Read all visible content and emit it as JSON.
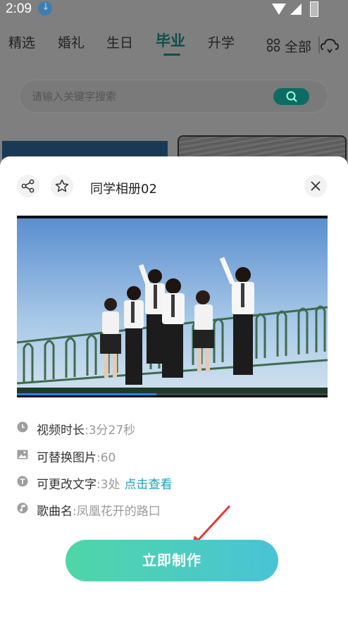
{
  "status_bar": {
    "time": "2:09"
  },
  "tabs": [
    {
      "label": "精选"
    },
    {
      "label": "婚礼"
    },
    {
      "label": "生日"
    },
    {
      "label": "毕业",
      "active": true
    },
    {
      "label": "升学"
    }
  ],
  "all_label": "全部",
  "search": {
    "placeholder": "请输入关键字搜索"
  },
  "sheet": {
    "title": "同学相册02",
    "video_progress": 0.45,
    "info": {
      "duration_label": "视频时长",
      "duration_value": ":3分27秒",
      "photos_label": "可替换图片",
      "photos_value": ":60",
      "text_label": "可更改文字",
      "text_value": ":3处",
      "text_link": "点击查看",
      "song_label": "歌曲名",
      "song_value": ":凤凰花开的路口"
    },
    "make_button": "立即制作"
  },
  "colors": {
    "accent_teal": "#0e4f49",
    "link": "#1aa0b8",
    "button_gradient_start": "#4fd6a7",
    "button_gradient_end": "#49c3d6",
    "arrow": "#e53935"
  }
}
